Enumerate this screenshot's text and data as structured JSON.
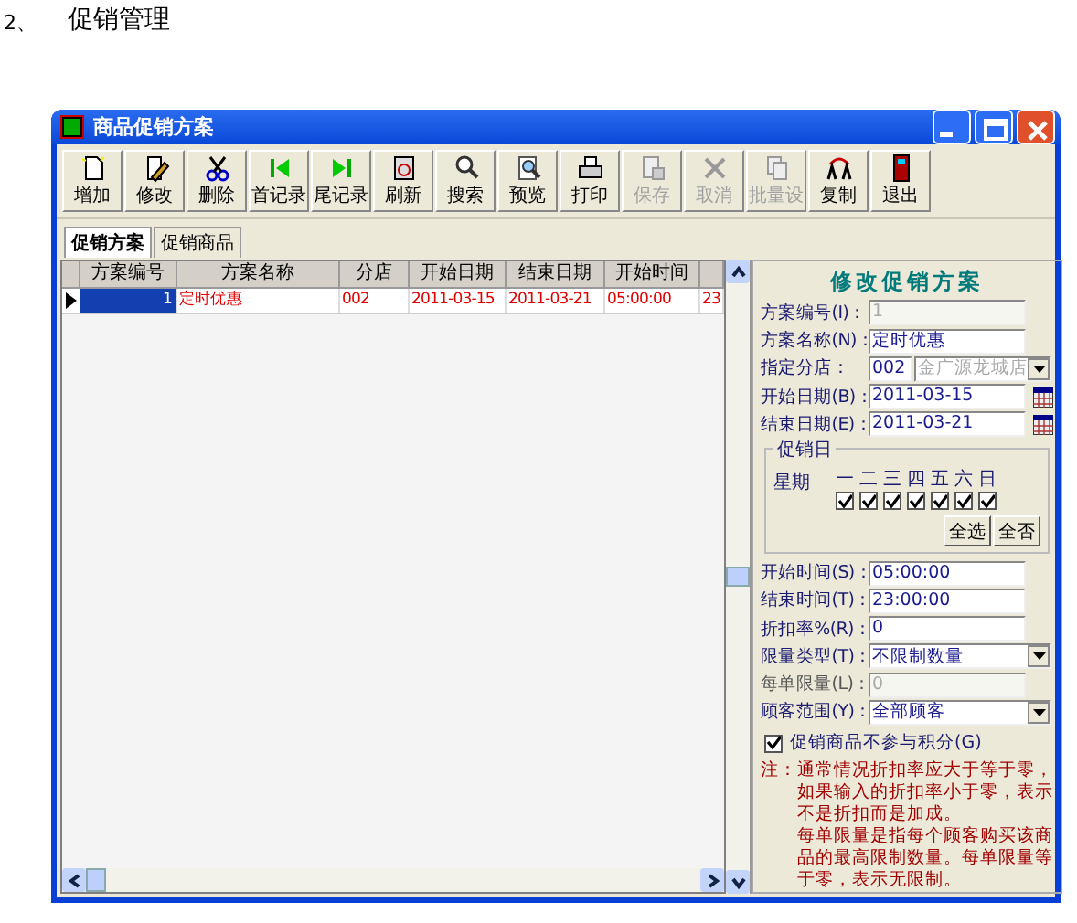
{
  "heading": {
    "number": "2、",
    "title": "促销管理"
  },
  "window": {
    "title": "商品促销方案"
  },
  "toolbar": [
    {
      "kind": "new",
      "label": "增加",
      "disabled": false
    },
    {
      "kind": "edit",
      "label": "修改",
      "disabled": false
    },
    {
      "kind": "delete",
      "label": "删除",
      "disabled": false
    },
    {
      "kind": "first",
      "label": "首记录",
      "disabled": false
    },
    {
      "kind": "last",
      "label": "尾记录",
      "disabled": false
    },
    {
      "kind": "refresh",
      "label": "刷新",
      "disabled": false
    },
    {
      "kind": "search",
      "label": "搜索",
      "disabled": false
    },
    {
      "kind": "preview",
      "label": "预览",
      "disabled": false
    },
    {
      "kind": "print",
      "label": "打印",
      "disabled": false
    },
    {
      "kind": "save",
      "label": "保存",
      "disabled": true
    },
    {
      "kind": "cancel",
      "label": "取消",
      "disabled": true
    },
    {
      "kind": "batch",
      "label": "批量设",
      "disabled": true
    },
    {
      "kind": "copy",
      "label": "复制",
      "disabled": false
    },
    {
      "kind": "exit",
      "label": "退出",
      "disabled": false
    }
  ],
  "tabs": [
    {
      "label": "促销方案",
      "selected": true
    },
    {
      "label": "促销商品",
      "selected": false
    }
  ],
  "table": {
    "columns": [
      "方案编号",
      "方案名称",
      "分店",
      "开始日期",
      "结束日期",
      "开始时间"
    ],
    "rows": [
      {
        "selected": true,
        "cells": [
          "1",
          "定时优惠",
          "002",
          "2011-03-15",
          "2011-03-21",
          "05:00:00",
          "23"
        ]
      }
    ]
  },
  "form": {
    "title": "修改促销方案",
    "fields_top": [
      {
        "kind": "text",
        "label": "方案编号(I)：",
        "value": "1",
        "disabled": true
      },
      {
        "kind": "text",
        "label": "方案名称(N)：",
        "value": "定时优惠",
        "disabled": false
      },
      {
        "kind": "store",
        "label": "指定分店：",
        "value": "002",
        "store_name": "金广源龙城店",
        "disabled": false
      },
      {
        "kind": "date",
        "label": "开始日期(B)：",
        "value": "2011-03-15",
        "disabled": false
      },
      {
        "kind": "date",
        "label": "结束日期(E)：",
        "value": "2011-03-21",
        "disabled": false
      }
    ],
    "days_group": {
      "title": "促销日",
      "row_label": "星期",
      "days": [
        {
          "label": "一",
          "checked": true
        },
        {
          "label": "二",
          "checked": true
        },
        {
          "label": "三",
          "checked": true
        },
        {
          "label": "四",
          "checked": true
        },
        {
          "label": "五",
          "checked": true
        },
        {
          "label": "六",
          "checked": true
        },
        {
          "label": "日",
          "checked": true
        }
      ],
      "buttons": [
        "全选",
        "全否"
      ]
    },
    "fields_bottom": [
      {
        "kind": "text",
        "label": "开始时间(S)：",
        "value": "05:00:00",
        "disabled": false
      },
      {
        "kind": "text",
        "label": "结束时间(T)：",
        "value": "23:00:00",
        "disabled": false
      },
      {
        "kind": "text",
        "label": "折扣率%(R)：",
        "value": "0",
        "disabled": false
      },
      {
        "kind": "combo",
        "label": "限量类型(T)：",
        "value": "不限制数量"
      },
      {
        "kind": "text",
        "label": "每单限量(L)：",
        "value": "0",
        "disabled": true
      },
      {
        "kind": "combo",
        "label": "顾客范围(Y)：",
        "value": "全部顾客"
      }
    ],
    "option": {
      "label": "促销商品不参与积分(G)",
      "checked": true
    },
    "note": {
      "prefix": "注：",
      "paragraphs": [
        "通常情况折扣率应大于等于零，如果输入的折扣率小于零，表示不是折扣而是加成。",
        "每单限量是指每个顾客购买该商品的最高限制数量。每单限量等于零，表示无限制。"
      ]
    }
  }
}
